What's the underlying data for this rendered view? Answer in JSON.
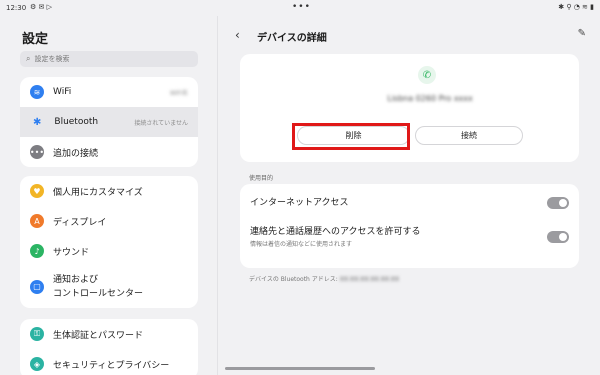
{
  "status_bar": {
    "time": "12:30",
    "left_icons": "⚙ ✉ ▷",
    "center": "•••",
    "right_icons": "✱ ⚲ ◔ ≋ ▮"
  },
  "left": {
    "title": "設定",
    "search_placeholder": "設定を検索",
    "group1": [
      {
        "label": "WiFi",
        "value": "WiFi名",
        "icon": "wifi-icon",
        "color": "#2f7ff0"
      },
      {
        "label": "Bluetooth",
        "value": "接続されていません",
        "icon": "bluetooth-icon",
        "color": "#2f7ff0"
      },
      {
        "label": "追加の接続",
        "value": "",
        "icon": "more-icon",
        "color": "#7d7d82"
      }
    ],
    "group2": [
      {
        "label": "個人用にカスタマイズ",
        "icon": "personalize-icon",
        "color": "#f2b526"
      },
      {
        "label": "ディスプレイ",
        "icon": "display-icon",
        "color": "#f07a2b"
      },
      {
        "label": "サウンド",
        "icon": "sound-icon",
        "color": "#2bb463"
      },
      {
        "label_line1": "通知および",
        "label_line2": "コントロールセンター",
        "icon": "notification-icon",
        "color": "#2f7ff0"
      }
    ],
    "group3": [
      {
        "label": "生体認証とパスワード",
        "icon": "lock-icon",
        "color": "#2bb3a2"
      },
      {
        "label": "セキュリティとプライバシー",
        "icon": "shield-icon",
        "color": "#2bb3a2"
      }
    ]
  },
  "right": {
    "title": "デバイスの詳細",
    "device_name": "Lisbna 0260 Pro xxxx",
    "delete_label": "削除",
    "connect_label": "接続",
    "section_label": "使用目的",
    "option1": "インターネットアクセス",
    "option2": "連絡先と通話履歴へのアクセスを許可する",
    "option2_sub": "情報は着信の通知などに使用されます",
    "address_label": "デバイスの Bluetooth アドレス:",
    "address_value": "XX:XX:XX:XX:XX:XX"
  },
  "colors": {
    "highlight_border": "#e01818",
    "call_green": "#2fb55f"
  }
}
